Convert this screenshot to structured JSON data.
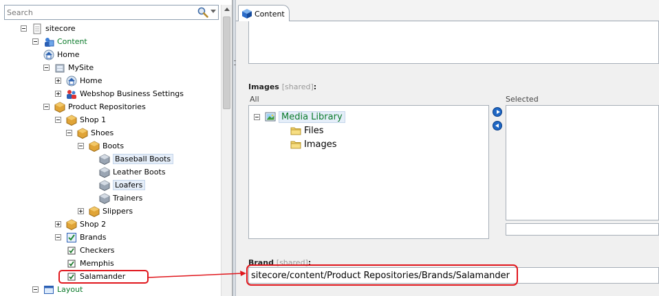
{
  "search": {
    "placeholder": "Search",
    "icon": "magnifier-icon"
  },
  "tree": [
    {
      "label": "sitecore",
      "toggle": "minus",
      "icon": "document-icon"
    },
    {
      "label": "Content",
      "toggle": "minus",
      "icon": "content-icon"
    },
    {
      "label": "Home",
      "icon": "home-icon"
    },
    {
      "label": "MySite",
      "toggle": "minus",
      "icon": "site-icon"
    },
    {
      "label": "Home",
      "toggle": "plus",
      "icon": "home-icon"
    },
    {
      "label": "Webshop Business Settings",
      "toggle": "plus",
      "icon": "settings-people-icon"
    },
    {
      "label": "Product Repositories",
      "toggle": "minus",
      "icon": "package-icon"
    },
    {
      "label": "Shop 1",
      "toggle": "minus",
      "icon": "package-icon"
    },
    {
      "label": "Shoes",
      "toggle": "minus",
      "icon": "package-icon"
    },
    {
      "label": "Boots",
      "toggle": "minus",
      "icon": "package-icon"
    },
    {
      "label": "Baseball Boots",
      "icon": "product-box-icon"
    },
    {
      "label": "Leather Boots",
      "icon": "product-box-icon"
    },
    {
      "label": "Loafers",
      "icon": "product-box-icon"
    },
    {
      "label": "Trainers",
      "icon": "product-box-icon"
    },
    {
      "label": "Slippers",
      "toggle": "plus",
      "icon": "package-icon"
    },
    {
      "label": "Shop 2",
      "toggle": "plus",
      "icon": "package-icon"
    },
    {
      "label": "Brands",
      "toggle": "minus",
      "icon": "checkbox-folder-icon"
    },
    {
      "label": "Checkers",
      "icon": "checkbox-icon"
    },
    {
      "label": "Memphis",
      "icon": "checkbox-icon"
    },
    {
      "label": "Salamander",
      "icon": "checkbox-icon"
    },
    {
      "label": "Layout",
      "toggle": "minus",
      "icon": "layout-icon"
    }
  ],
  "tab": {
    "label": "Content",
    "icon": "cube-icon"
  },
  "images_field": {
    "label": "Images",
    "shared": "[shared]",
    "colon": ":",
    "all_label": "All",
    "selected_label": "Selected",
    "media_tree": [
      {
        "label": "Media Library",
        "icon": "image-icon"
      },
      {
        "label": "Files",
        "icon": "folder-icon"
      },
      {
        "label": "Images",
        "icon": "folder-icon"
      }
    ]
  },
  "brand_field": {
    "label": "Brand",
    "shared": "[shared]",
    "colon": ":",
    "value": "sitecore/content/Product Repositories/Brands/Salamander"
  },
  "colors": {
    "highlight": "#e0151b",
    "accent": "#1f67c4",
    "tree_green": "#0a7a2a"
  }
}
